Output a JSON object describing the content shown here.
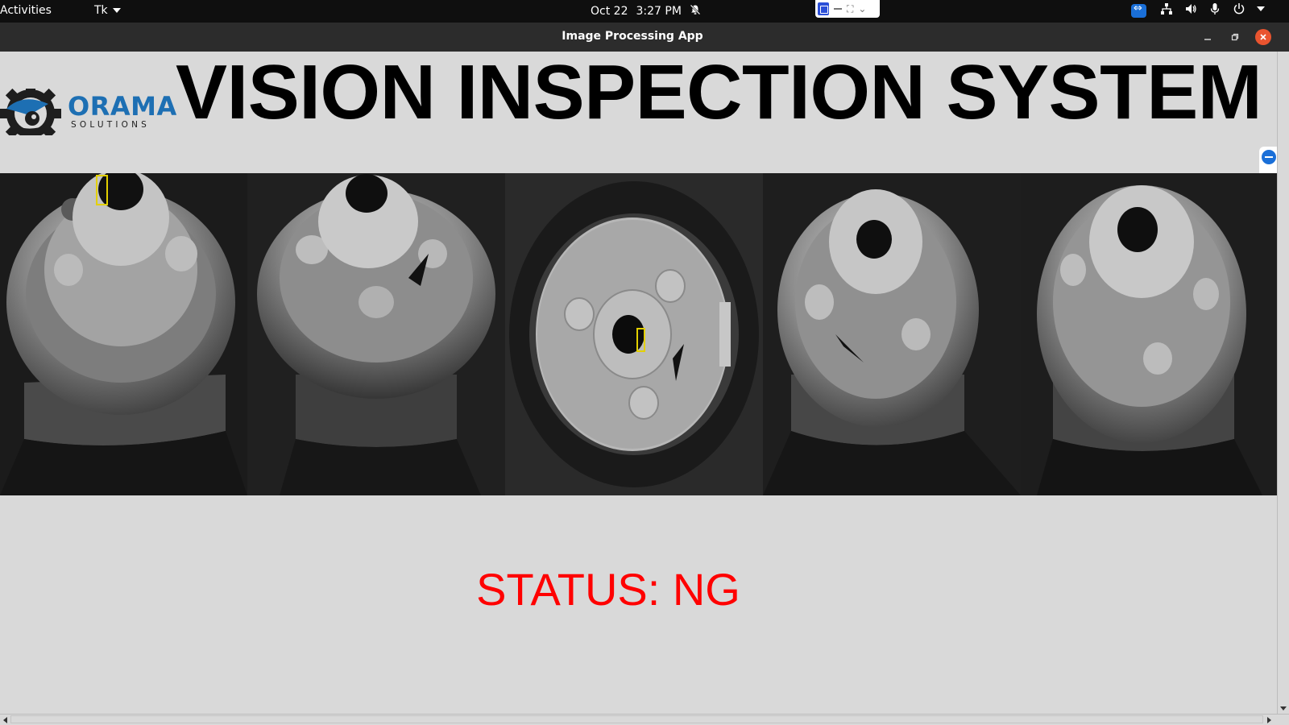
{
  "system_bar": {
    "activities_label": "Activities",
    "app_menu_label": "Tk",
    "date": "Oct 22",
    "time": "3:27 PM",
    "notification_icon": "bell-muted-icon",
    "tray_icons": [
      "teamviewer-icon",
      "network-icon",
      "volume-icon",
      "microphone-icon",
      "power-icon"
    ]
  },
  "window": {
    "title": "Image Processing App"
  },
  "header": {
    "logo_name": "ORAMA",
    "logo_subtitle": "SOLUTIONS",
    "headline": "VISION INSPECTION SYSTEM"
  },
  "cameras": [
    {
      "view": "angled",
      "defects": 1
    },
    {
      "view": "angled",
      "defects": 0
    },
    {
      "view": "top-down",
      "defects": 1
    },
    {
      "view": "angled",
      "defects": 0
    },
    {
      "view": "angled",
      "defects": 0
    }
  ],
  "status": {
    "text": "STATUS: NG",
    "color": "#ff0000"
  },
  "colors": {
    "brand_blue": "#1d6fb3",
    "defect_box": "#e3d000",
    "close_button": "#e9542f"
  }
}
